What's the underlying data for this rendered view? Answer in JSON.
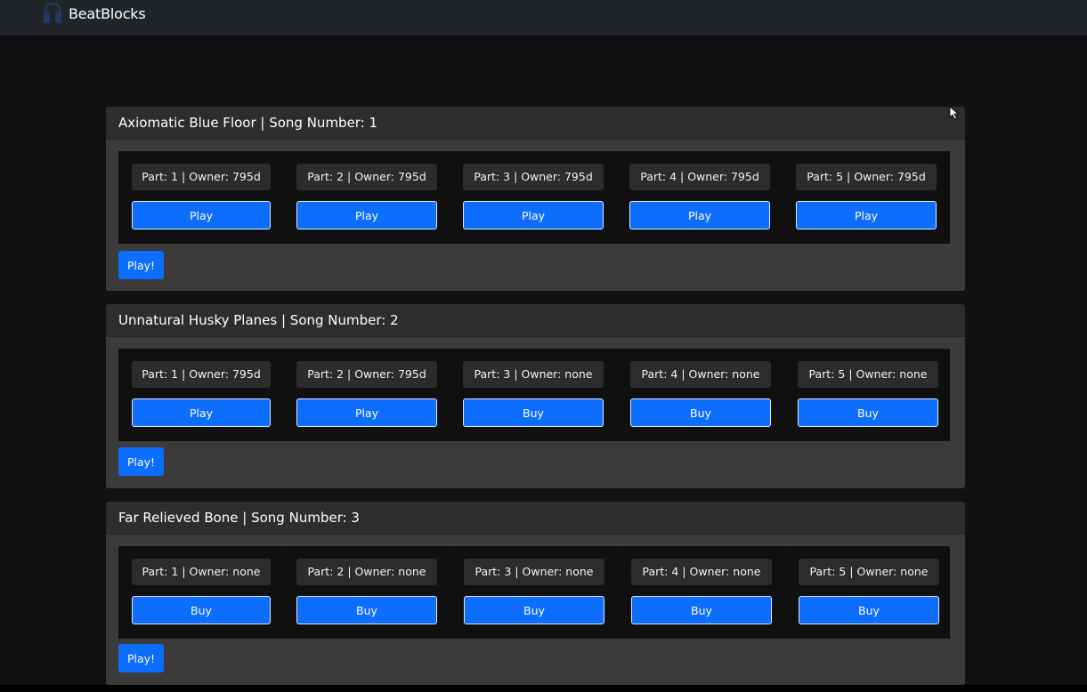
{
  "app": {
    "brand": "BeatBlocks"
  },
  "songs": [
    {
      "header": "Axiomatic Blue Floor | Song Number: 1",
      "play_all_label": "Play!",
      "parts": [
        {
          "label": "Part: 1 | Owner: 795d",
          "action": "Play"
        },
        {
          "label": "Part: 2 | Owner: 795d",
          "action": "Play"
        },
        {
          "label": "Part: 3 | Owner: 795d",
          "action": "Play"
        },
        {
          "label": "Part: 4 | Owner: 795d",
          "action": "Play"
        },
        {
          "label": "Part: 5 | Owner: 795d",
          "action": "Play"
        }
      ]
    },
    {
      "header": "Unnatural Husky Planes | Song Number: 2",
      "play_all_label": "Play!",
      "parts": [
        {
          "label": "Part: 1 | Owner: 795d",
          "action": "Play"
        },
        {
          "label": "Part: 2 | Owner: 795d",
          "action": "Play"
        },
        {
          "label": "Part: 3 | Owner: none",
          "action": "Buy"
        },
        {
          "label": "Part: 4 | Owner: none",
          "action": "Buy"
        },
        {
          "label": "Part: 5 | Owner: none",
          "action": "Buy"
        }
      ]
    },
    {
      "header": "Far Relieved Bone | Song Number: 3",
      "play_all_label": "Play!",
      "parts": [
        {
          "label": "Part: 1 | Owner: none",
          "action": "Buy"
        },
        {
          "label": "Part: 2 | Owner: none",
          "action": "Buy"
        },
        {
          "label": "Part: 3 | Owner: none",
          "action": "Buy"
        },
        {
          "label": "Part: 4 | Owner: none",
          "action": "Buy"
        },
        {
          "label": "Part: 5 | Owner: none",
          "action": "Buy"
        }
      ]
    }
  ],
  "colors": {
    "primary": "#0d6efd",
    "background": "#111113",
    "card": "#3b3b3c",
    "navbar": "#212529"
  }
}
